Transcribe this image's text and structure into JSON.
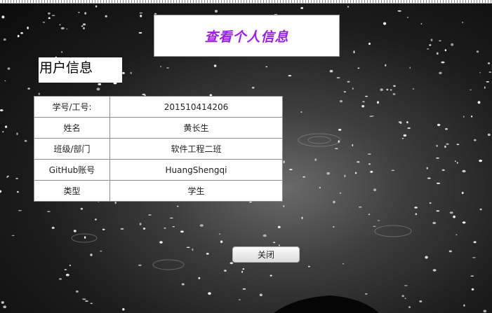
{
  "page": {
    "title": "查看个人信息",
    "section_heading": "用户信息",
    "title_color": "#9b1fe0"
  },
  "user_info": {
    "rows": [
      {
        "label": "学号/工号:",
        "value": "201510414206"
      },
      {
        "label": "姓名",
        "value": "黄长生"
      },
      {
        "label": "班级/部门",
        "value": "软件工程二班"
      },
      {
        "label": "GitHub账号",
        "value": "HuangShengqi"
      },
      {
        "label": "类型",
        "value": "学生"
      }
    ]
  },
  "actions": {
    "close_label": "关闭"
  }
}
